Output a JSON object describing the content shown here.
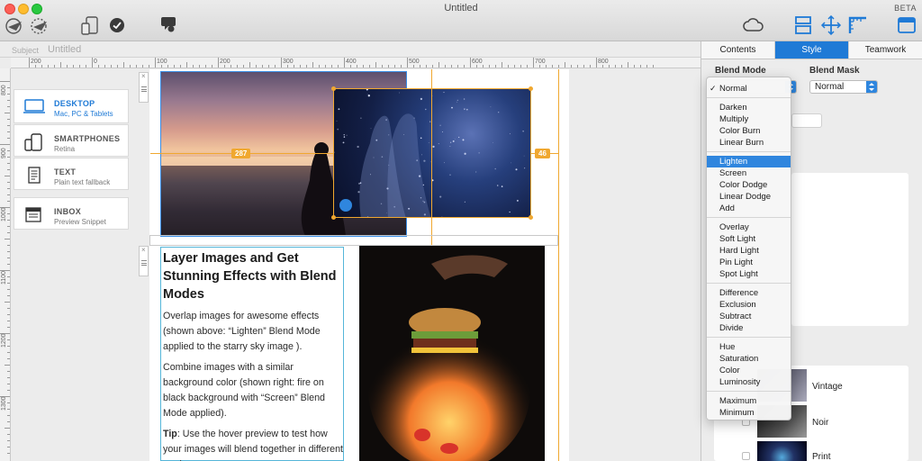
{
  "window": {
    "title": "Untitled",
    "beta": "BETA"
  },
  "subject": {
    "label": "Subject",
    "value": "Untitled"
  },
  "ruler": {
    "h_labels": [
      "200",
      "0",
      "100",
      "200",
      "300",
      "400",
      "500",
      "600",
      "700",
      "800"
    ],
    "v_labels": [
      "800",
      "900",
      "1000",
      "1100",
      "1200",
      "1300"
    ]
  },
  "devices": [
    {
      "title": "DESKTOP",
      "subtitle": "Mac, PC & Tablets",
      "icon": "desktop-icon",
      "active": true
    },
    {
      "title": "SMARTPHONES",
      "subtitle": "Retina",
      "icon": "smartphone-icon",
      "active": false
    },
    {
      "title": "TEXT",
      "subtitle": "Plain text fallback",
      "icon": "text-doc-icon",
      "active": false
    },
    {
      "title": "INBOX",
      "subtitle": "Preview Snippet",
      "icon": "inbox-icon",
      "active": false
    }
  ],
  "measure": {
    "left": "287",
    "right": "46"
  },
  "content": {
    "heading": "Layer Images and Get Stunning Effects with Blend Modes",
    "p1": "Overlap images for awesome effects (shown above: “Lighten” Blend Mode applied to the starry sky image ).",
    "p2": "Combine images with a similar background color (shown right: fire on black background with “Screen” Blend Mode applied).",
    "p3_bold": "Tip",
    "p3": ": Use the hover preview to test how your images will blend together in different modes."
  },
  "panel": {
    "tabs": [
      "Contents",
      "Style",
      "Teamwork"
    ],
    "active_tab": "Style",
    "blend_mode_label": "Blend Mode",
    "blend_mask_label": "Blend Mask",
    "blend_mask_value": "Normal",
    "filters": [
      "Vintage",
      "Noir",
      "Print"
    ]
  },
  "blend_menu": {
    "selected": "Normal",
    "highlighted": "Lighten",
    "groups": [
      [
        "Normal"
      ],
      [
        "Darken",
        "Multiply",
        "Color Burn",
        "Linear Burn"
      ],
      [
        "Lighten",
        "Screen",
        "Color Dodge",
        "Linear Dodge",
        "Add"
      ],
      [
        "Overlay",
        "Soft Light",
        "Hard Light",
        "Pin Light",
        "Spot Light"
      ],
      [
        "Difference",
        "Exclusion",
        "Subtract",
        "Divide"
      ],
      [
        "Hue",
        "Saturation",
        "Color",
        "Luminosity"
      ],
      [
        "Maximum",
        "Minimum"
      ]
    ]
  },
  "colors": {
    "accent": "#1f7ad6",
    "guide": "#f0a830",
    "selection": "#3a8ee6"
  }
}
